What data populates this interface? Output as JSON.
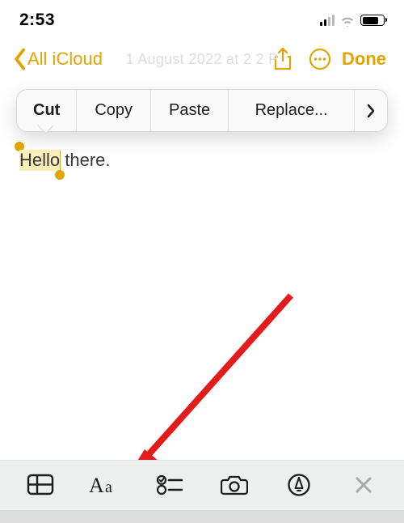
{
  "status": {
    "time": "2:53"
  },
  "nav": {
    "back_label": "All iCloud",
    "faded_title": "1 August 2022 at 2   2 P",
    "done_label": "Done"
  },
  "popover": {
    "cut": "Cut",
    "copy": "Copy",
    "paste": "Paste",
    "replace": "Replace..."
  },
  "note": {
    "selected_text": "Hello",
    "rest_text": " there."
  },
  "colors": {
    "accent": "#e1a400"
  }
}
